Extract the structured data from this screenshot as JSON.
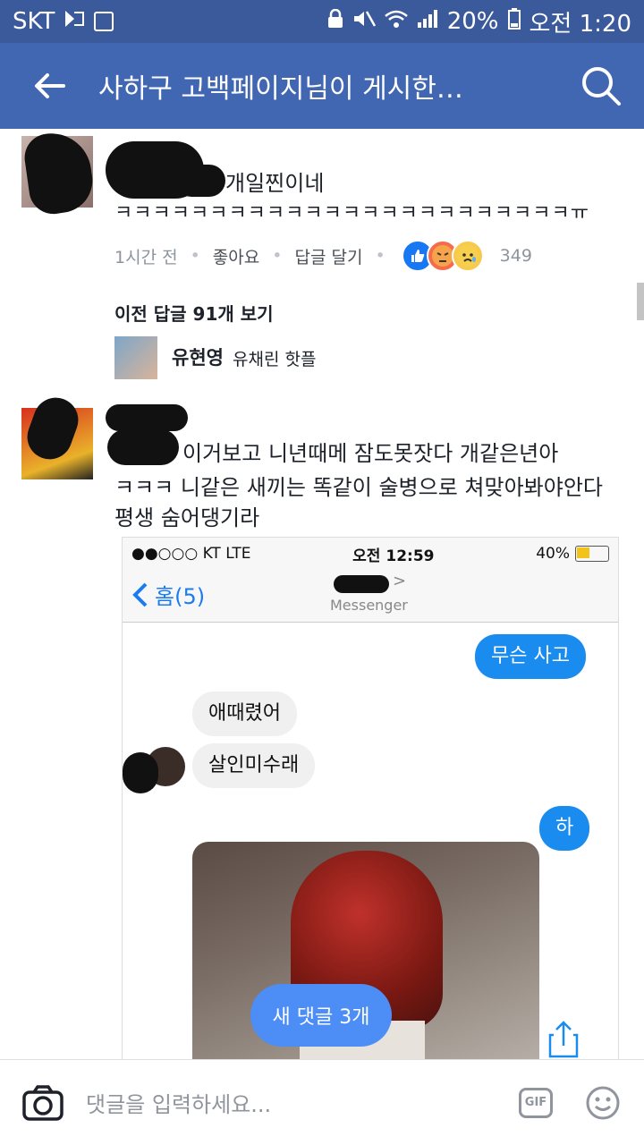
{
  "status_bar": {
    "carrier": "SKT",
    "battery": "20%",
    "time": "오전 1:20"
  },
  "app_bar": {
    "title": "사하구 고백페이지님이 게시한…"
  },
  "comment1": {
    "text_line1": "개일찐이네",
    "text_line2": "ㅋㅋㅋㅋㅋㅋㅋㅋㅋㅋㅋㅋㅋㅋㅋㅋㅋㅋㅋㅋㅋㅋㅋㅋㅠ",
    "time": "1시간 전",
    "like": "좋아요",
    "reply": "답글 달기",
    "reaction_count": "349"
  },
  "replies": {
    "view_prev": "이전 답글 91개 보기",
    "reply_name": "유현영",
    "reply_text": "유채린 핫플"
  },
  "comment2": {
    "line1": "이거보고 니년때메 잠도못잣다 개같은년아",
    "line2": "ㅋㅋㅋ 니같은 새끼는 똑같이 술병으로 쳐맞아봐야안다",
    "line3": "평생 숨어댕기라"
  },
  "screenshot": {
    "carrier": "●●○○○ KT  LTE",
    "time": "오전 12:59",
    "battery": "40%",
    "back_label": "홈(5)",
    "nav_sub": "Messenger",
    "msg_sent_1": "무슨 사고",
    "msg_recv_1": "애때렸어",
    "msg_recv_2": "살인미수래",
    "msg_sent_2": "하"
  },
  "new_comments_button": "새 댓글 3개",
  "composer": {
    "placeholder": "댓글을 입력하세요...",
    "gif_label": "GIF"
  },
  "colors": {
    "appbar": "#4267b2",
    "statusbar": "#3b5a9c",
    "messenger_blue": "#1a8cf0"
  }
}
